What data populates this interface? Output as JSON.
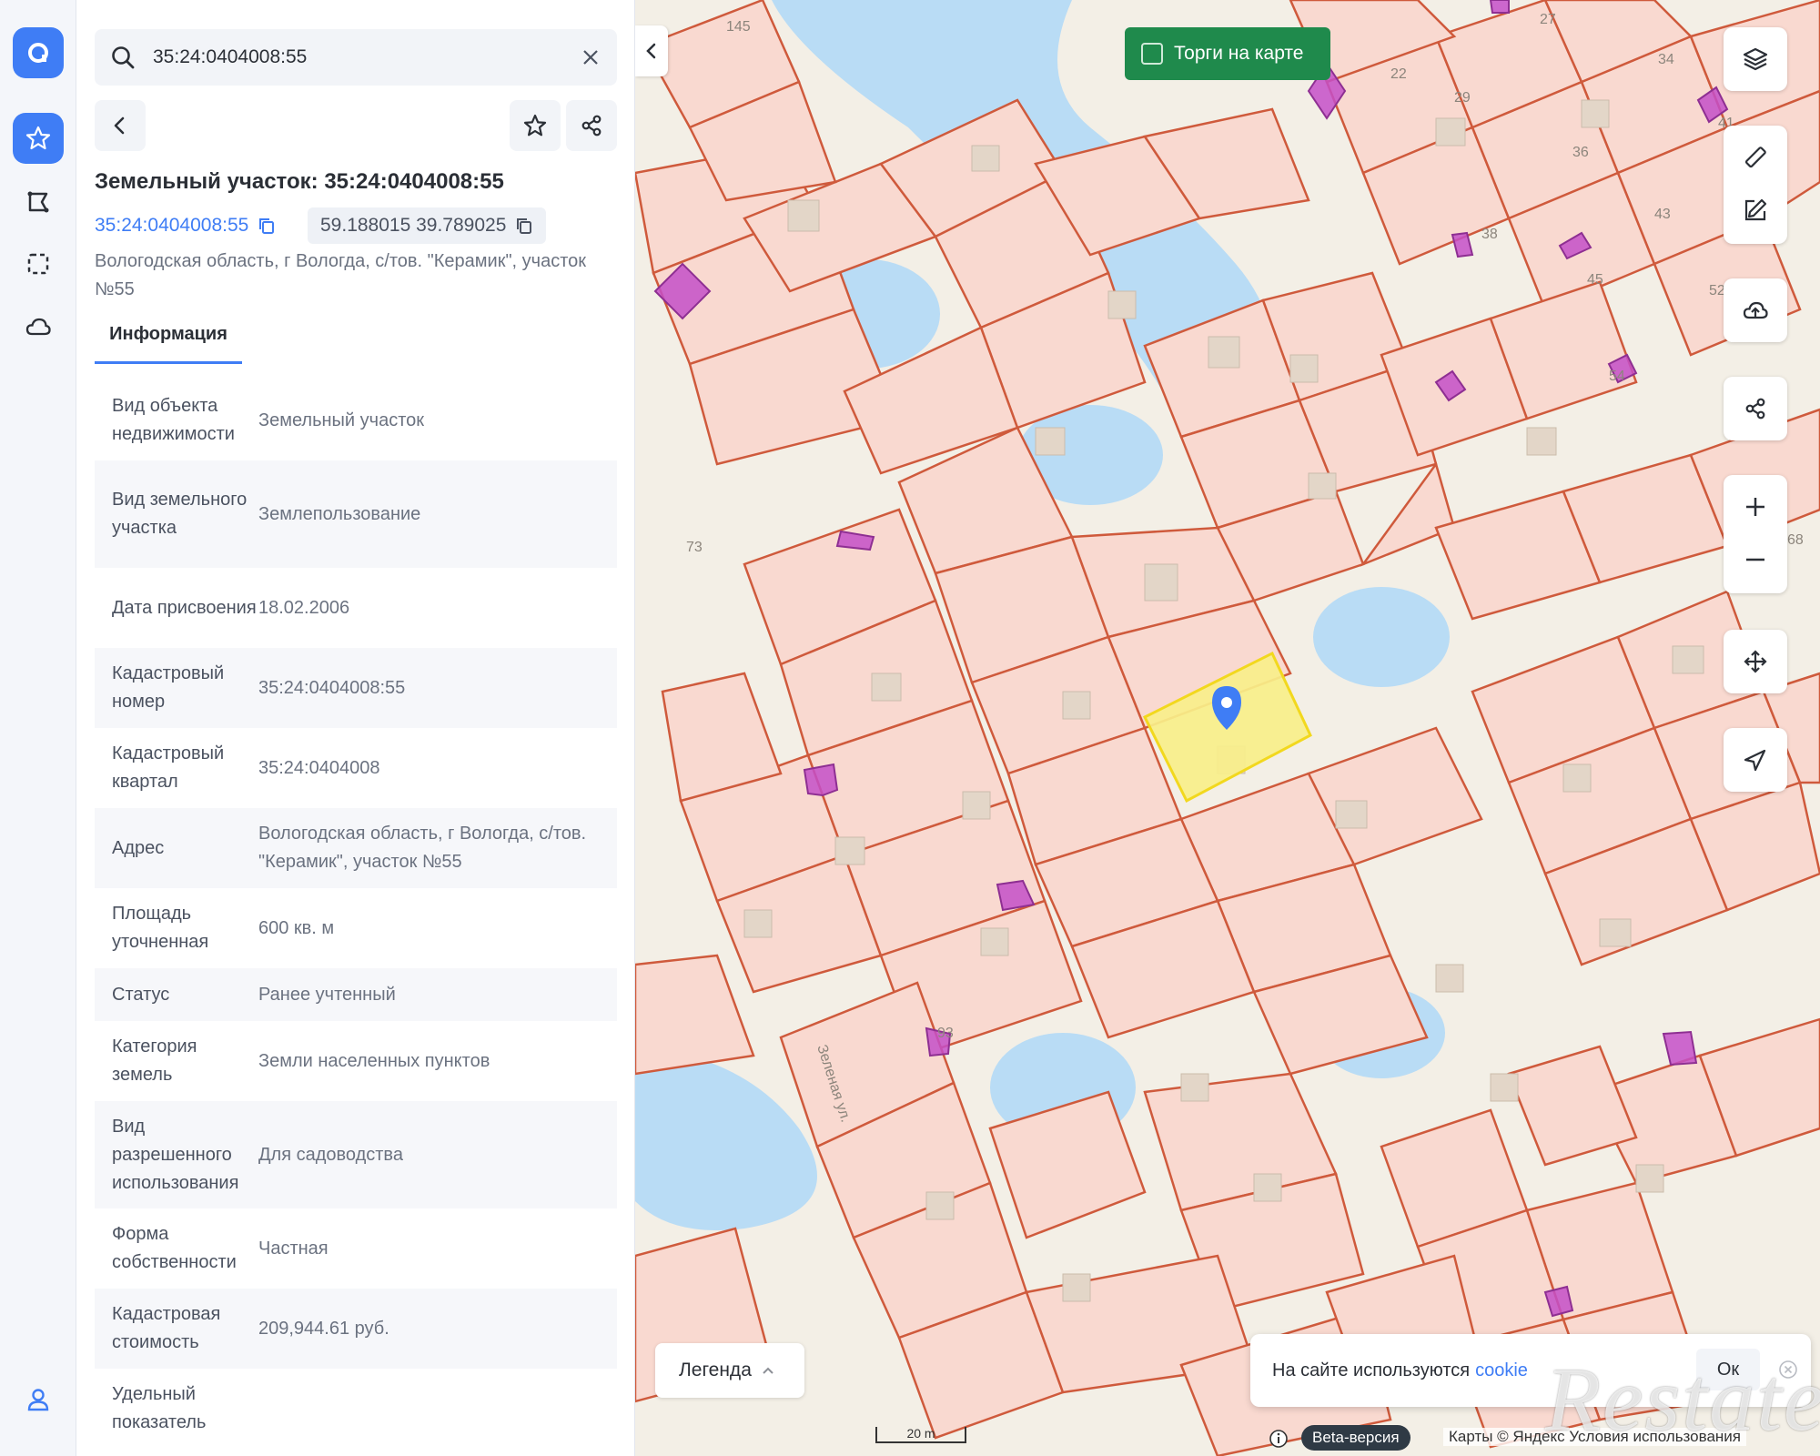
{
  "colors": {
    "accent": "#3f7df5",
    "auction_green": "#1f8a4c",
    "parcel_fill": "#f9d9d0",
    "parcel_stroke": "#cf5a3c",
    "water": "#b9dcf5",
    "selected_parcel": "#f8ef8a",
    "building_highlight": "#c44fc8"
  },
  "rail": {
    "icons": [
      "app-logo-icon",
      "star-icon",
      "route-icon",
      "select-area-icon",
      "cloud-icon",
      "user-icon"
    ]
  },
  "search": {
    "value": "35:24:0404008:55",
    "placeholder": ""
  },
  "object": {
    "title": "Земельный участок: 35:24:0404008:55",
    "cadastral_number": "35:24:0404008:55",
    "coordinates": "59.188015 39.789025",
    "address": "Вологодская область, г Вологда, с/тов. \"Керамик\", участок №55"
  },
  "tabs": [
    {
      "label": "Информация",
      "active": true
    }
  ],
  "properties": [
    {
      "label": "Вид объекта недвижимости",
      "value": "Земельный участок"
    },
    {
      "label": "Вид земельного участка",
      "value": "Землепользование"
    },
    {
      "label": "Дата присвоения",
      "value": "18.02.2006"
    },
    {
      "label": "Кадастровый номер",
      "value": "35:24:0404008:55"
    },
    {
      "label": "Кадастровый квартал",
      "value": "35:24:0404008"
    },
    {
      "label": "Адрес",
      "value": "Вологодская область, г Вологда, с/тов. \"Керамик\", участок №55"
    },
    {
      "label": "Площадь уточненная",
      "value": "600 кв. м"
    },
    {
      "label": "Статус",
      "value": "Ранее учтенный"
    },
    {
      "label": "Категория земель",
      "value": "Земли населенных пунктов"
    },
    {
      "label": "Вид разрешенного использования",
      "value": "Для садоводства"
    },
    {
      "label": "Форма собственности",
      "value": "Частная"
    },
    {
      "label": "Кадастровая стоимость",
      "value": "209,944.61 руб."
    },
    {
      "label": "Удельный показатель",
      "value": ""
    }
  ],
  "map": {
    "auction_toggle_label": "Торги на карте",
    "legend_label": "Легенда",
    "street_label": "Зеленая ул.",
    "plot_numbers": [
      "145",
      "22",
      "29",
      "27",
      "34",
      "36",
      "41",
      "43",
      "38",
      "45",
      "52",
      "54",
      "68",
      "73",
      "93"
    ],
    "scale_label": "20 m",
    "beta_badge": "Beta-версия",
    "attribution": "Карты © Яндекс Условия использования",
    "cookie_text": "На сайте используются",
    "cookie_link": "cookie",
    "cookie_ok": "Ок",
    "watermark": "Restate"
  }
}
